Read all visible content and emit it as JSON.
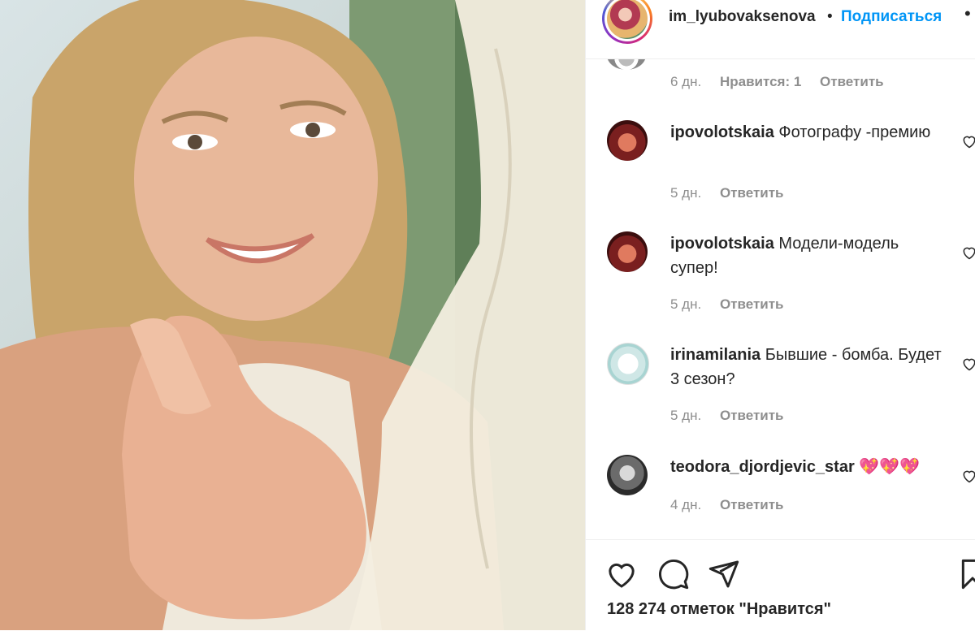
{
  "header": {
    "username": "im_lyubovaksenova",
    "dot": "•",
    "follow_label": "Подписаться",
    "more": "•"
  },
  "comments": {
    "top_meta": {
      "time": "6 дн.",
      "likes": "Нравится: 1",
      "reply": "Ответить"
    },
    "items": [
      {
        "user": "ipovolotskaia",
        "text": "Фотографу -премию",
        "time": "5 дн.",
        "reply": "Ответить"
      },
      {
        "user": "ipovolotskaia",
        "text": "Модели-модель супер!",
        "time": "5 дн.",
        "reply": "Ответить"
      },
      {
        "user": "irinamilania",
        "text": "Бывшие - бомба. Будет 3 сезон?",
        "time": "5 дн.",
        "reply": "Ответить"
      },
      {
        "user": "teodora_djordjevic_star",
        "text": "💖💖💖",
        "time": "4 дн.",
        "reply": "Ответить"
      }
    ]
  },
  "footer": {
    "likes_text": "128 274 отметок \"Нравится\""
  },
  "icons": [
    "heart-icon",
    "comment-icon",
    "share-icon",
    "bookmark-icon"
  ]
}
